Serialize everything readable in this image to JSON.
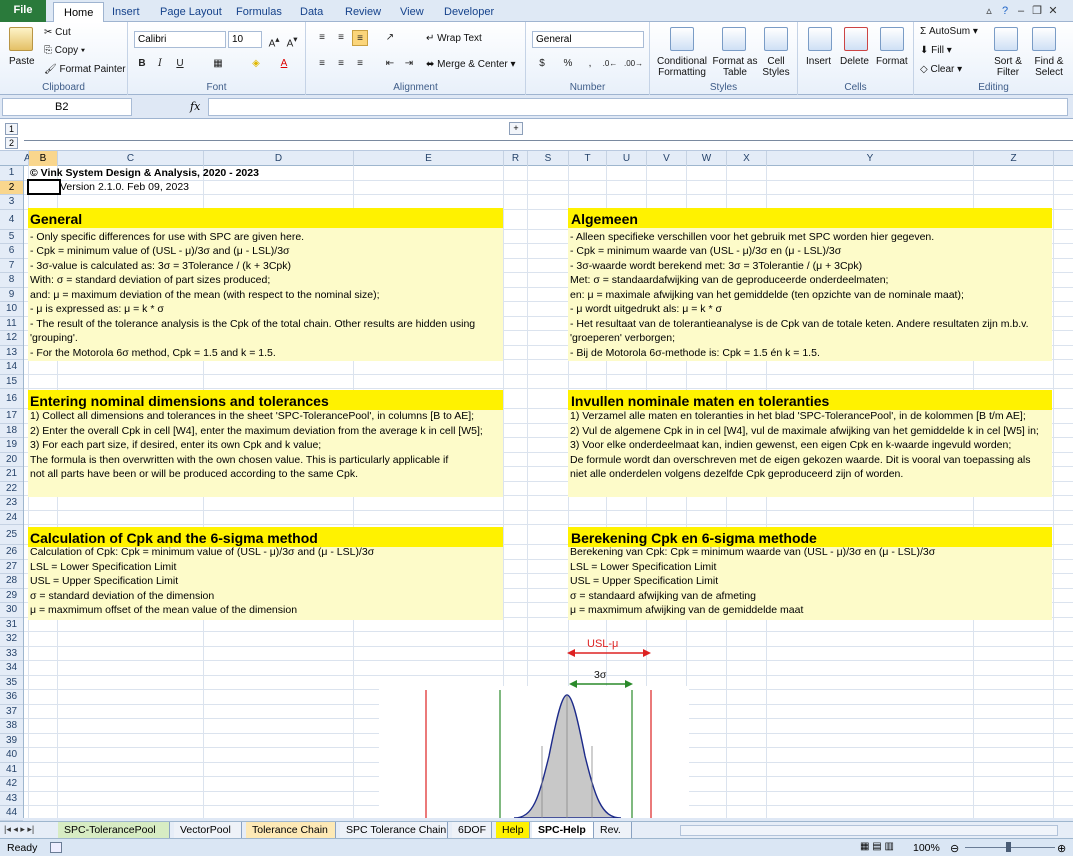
{
  "tabs": {
    "file": "File",
    "items": [
      "Home",
      "Insert",
      "Page Layout",
      "Formulas",
      "Data",
      "Review",
      "View",
      "Developer"
    ],
    "active": "Home"
  },
  "ribbon": {
    "clipboard": {
      "paste": "Paste",
      "cut": "Cut",
      "copy": "Copy",
      "format_painter": "Format Painter",
      "label": "Clipboard"
    },
    "font": {
      "name": "Calibri",
      "size": "10",
      "label": "Font"
    },
    "alignment": {
      "wrap": "Wrap Text",
      "merge": "Merge & Center",
      "label": "Alignment"
    },
    "number": {
      "format": "General",
      "label": "Number"
    },
    "styles": {
      "cond": "Conditional Formatting",
      "table": "Format as Table",
      "cell": "Cell Styles",
      "label": "Styles"
    },
    "cells": {
      "insert": "Insert",
      "delete": "Delete",
      "format": "Format",
      "label": "Cells"
    },
    "editing": {
      "autosum": "AutoSum",
      "fill": "Fill",
      "clear": "Clear",
      "sort": "Sort & Filter",
      "find": "Find & Select",
      "label": "Editing"
    }
  },
  "formula_bar": {
    "name_box": "B2",
    "fx": "fx",
    "value": ""
  },
  "outline": {
    "levels": [
      "1",
      "2"
    ],
    "expand": "+"
  },
  "columns": [
    "A",
    "B",
    "C",
    "D",
    "E",
    "R",
    "S",
    "T",
    "U",
    "V",
    "W",
    "X",
    "Y",
    "Z"
  ],
  "rows": [
    "1",
    "2",
    "3",
    "4",
    "5",
    "6",
    "7",
    "8",
    "9",
    "10",
    "11",
    "12",
    "13",
    "14",
    "15",
    "16",
    "17",
    "18",
    "19",
    "20",
    "21",
    "22",
    "23",
    "24",
    "25",
    "26",
    "27",
    "28",
    "29",
    "30",
    "31",
    "32",
    "33",
    "34",
    "35",
    "36",
    "37",
    "38",
    "39",
    "40",
    "41",
    "42",
    "43",
    "44"
  ],
  "cells": {
    "copyright": "© Vink System Design & Analysis, 2020 - 2023",
    "version": "Version 2.1.0.  Feb 09, 2023",
    "en": {
      "general_title": "General",
      "general": [
        " - Only specific differences for use with SPC are given here.",
        " - Cpk = minimum value of (USL - μ)/3σ and (μ - LSL)/3σ",
        " - 3σ-value is calculated as: 3σ = 3Tolerance / (k + 3Cpk)",
        "     With: σ = standard deviation of part sizes produced;",
        "        and: μ = maximum deviation of the mean (with respect to the nominal size);",
        " - μ is expressed as: μ = k * σ",
        " - The result of the tolerance analysis is the Cpk of the total chain. Other results are hidden using",
        "    'grouping'.",
        " - For the Motorola 6σ method, Cpk = 1.5 and k = 1.5."
      ],
      "entering_title": "Entering nominal dimensions and tolerances",
      "entering": [
        "  1) Collect all dimensions and tolerances in the sheet 'SPC-TolerancePool', in columns [B to AE];",
        "  2) Enter the overall Cpk in cell [W4], enter the maximum deviation from the average k in cell [W5];",
        "  3) For each part size, if desired, enter its own Cpk and k value;",
        "       The formula is then overwritten with the own chosen value. This is particularly applicable if",
        "       not all parts have been or will be produced according to the same Cpk."
      ],
      "calc_title": "Calculation of Cpk and the 6-sigma method",
      "calc": [
        "Calculation of Cpk: Cpk = minimum value of (USL - μ)/3σ  and  (μ - LSL)/3σ",
        "LSL = Lower Specification Limit",
        "USL = Upper Specification Limit",
        "σ = standard deviation of the dimension",
        "μ = maxmimum offset of the mean value of the dimension"
      ]
    },
    "nl": {
      "general_title": "Algemeen",
      "general": [
        " - Alleen specifieke verschillen voor het gebruik met SPC worden hier gegeven.",
        " - Cpk = minimum waarde van (USL - μ)/3σ  en  (μ - LSL)/3σ",
        " - 3σ-waarde wordt berekend met: 3σ = 3Tolerantie / (μ + 3Cpk)",
        "     Met: σ = standaardafwijking van de geproduceerde onderdeelmaten;",
        "        en: μ = maximale afwijking van het gemiddelde (ten opzichte van de nominale maat);",
        " - μ wordt uitgedrukt als: μ = k * σ",
        " - Het resultaat van de tolerantieanalyse is de Cpk van de totale keten. Andere resultaten zijn m.b.v.",
        "    'groeperen' verborgen;",
        " - Bij de Motorola 6σ-methode is: Cpk = 1.5  én  k = 1.5."
      ],
      "entering_title": "Invullen nominale maten en toleranties",
      "entering": [
        "  1) Verzamel alle maten en toleranties in het blad 'SPC-TolerancePool', in de kolommen [B t/m AE];",
        "  2) Vul de algemene Cpk in in cel [W4], vul de maximale afwijking van het gemiddelde k in cel [W5] in;",
        "  3) Voor elke onderdeelmaat kan, indien gewenst, een eigen Cpk en k-waarde ingevuld worden;",
        "       De formule wordt dan overschreven met de eigen gekozen waarde. Dit is vooral van toepassing als",
        "       niet alle onderdelen volgens dezelfde Cpk geproduceerd zijn of worden."
      ],
      "calc_title": "Berekening Cpk en 6-sigma methode",
      "calc": [
        "Berekening van Cpk: Cpk = minimum waarde van (USL - μ)/3σ  en  (μ - LSL)/3σ",
        "LSL = Lower Specification Limit",
        "USL = Upper Specification Limit",
        "σ = standaard afwijking van de afmeting",
        "μ = maxmimum afwijking van de gemiddelde maat"
      ]
    },
    "diagram": {
      "usl_mu": "USL-μ",
      "three_sigma": "3σ"
    }
  },
  "sheet_tabs": [
    "SPC-TolerancePool",
    "VectorPool",
    "Tolerance Chain",
    "SPC Tolerance Chain",
    "6DOF",
    "Help",
    "SPC-Help",
    "Rev."
  ],
  "active_sheet": "SPC-Help",
  "status": {
    "ready": "Ready",
    "zoom": "100%"
  }
}
